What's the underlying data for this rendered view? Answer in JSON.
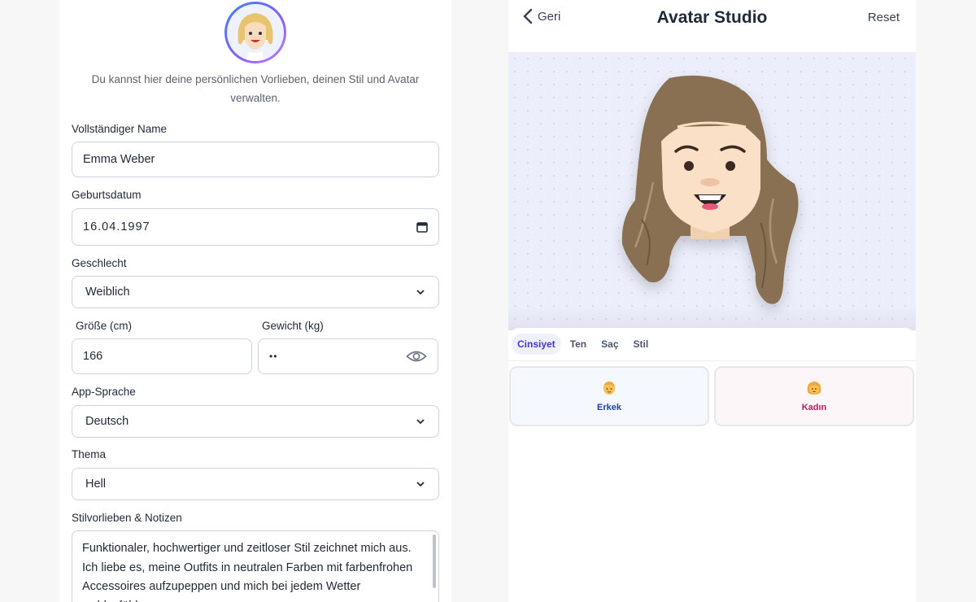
{
  "profile": {
    "intro": "Du kannst hier deine persönlichen Vorlieben, deinen Stil und Avatar verwalten.",
    "name_label": "Vollständiger Name",
    "name_value": "Emma Weber",
    "birth_label": "Geburtsdatum",
    "birth_value": "16.04.1997",
    "gender_label": "Geschlecht",
    "gender_value": "Weiblich",
    "height_label": "Größe (cm)",
    "height_value": "166",
    "weight_label": "Gewicht (kg)",
    "weight_value": "••",
    "language_label": "App-Sprache",
    "language_value": "Deutsch",
    "theme_label": "Thema",
    "theme_value": "Hell",
    "notes_label": "Stilvorlieben & Notizen",
    "notes_value": "Funktionaler, hochwertiger und zeitloser Stil zeichnet mich aus. Ich liebe es, meine Outfits in neutralen Farben mit farbenfrohen Accessoires aufzupeppen und mich bei jedem Wetter wohlzufühlen."
  },
  "studio": {
    "back_label": "Geri",
    "title": "Avatar Studio",
    "reset_label": "Reset",
    "tabs": [
      "Cinsiyet",
      "Ten",
      "Saç",
      "Stil"
    ],
    "active_tab": "Cinsiyet",
    "options": [
      {
        "label": "Erkek",
        "emoji": "👱"
      },
      {
        "label": "Kadın",
        "emoji": "👩"
      }
    ]
  },
  "colors": {
    "accent": "#4338ca",
    "hair": "#8a7052",
    "skin": "#fbe0c8",
    "male_text": "#1e40af",
    "female_text": "#be185d"
  },
  "icons": [
    "chevron-left-icon",
    "calendar-icon",
    "chevron-down-icon",
    "eye-icon"
  ]
}
